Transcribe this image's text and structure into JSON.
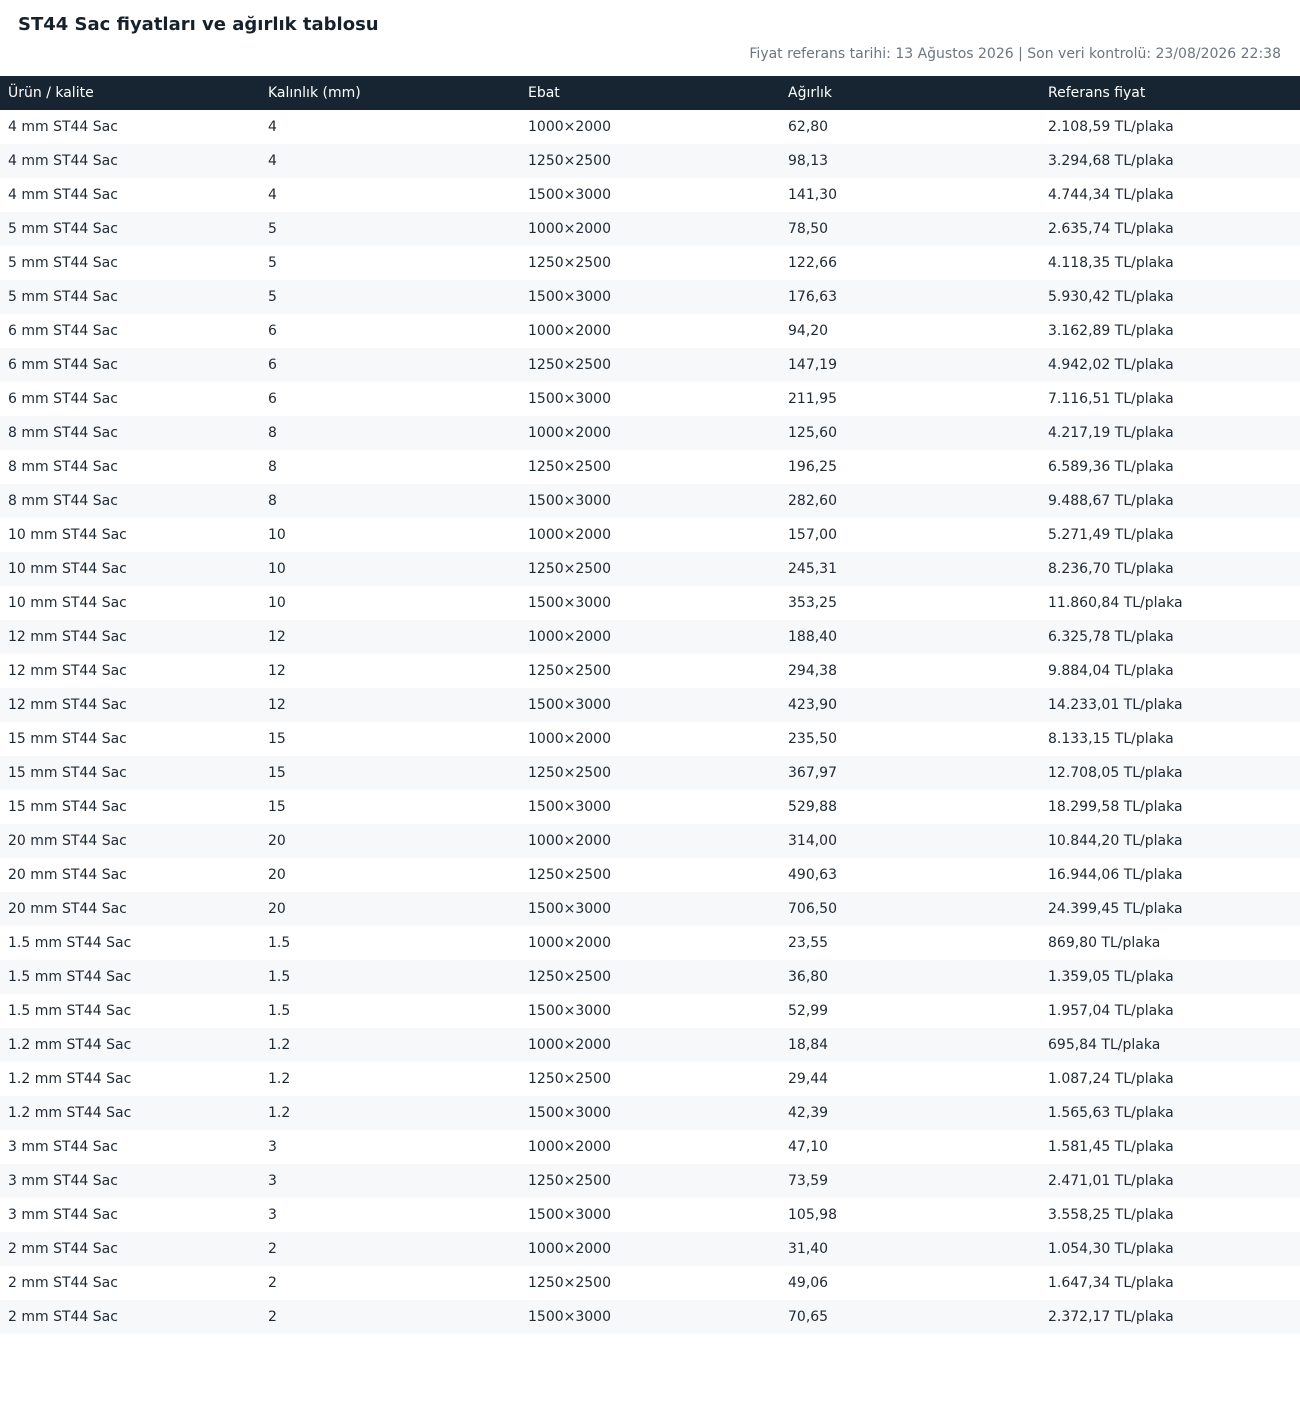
{
  "page": {
    "title": "ST44 Sac fiyatları ve ağırlık tablosu",
    "meta": "Fiyat referans tarihi: 13 Ağustos 2026 | Son veri kontrolü: 23/08/2026 22:38"
  },
  "colors": {
    "header_bg": "#172532",
    "header_text": "#ffffff",
    "row_alt_bg": "#f6f8fa",
    "meta_text": "#6c7580"
  },
  "table": {
    "headers": [
      "Ürün / kalite",
      "Kalınlık (mm)",
      "Ebat",
      "Ağırlık",
      "Referans fiyat"
    ],
    "rows": [
      [
        "4 mm ST44 Sac",
        "4",
        "1000×2000",
        "62,80",
        "2.108,59 TL/plaka"
      ],
      [
        "4 mm ST44 Sac",
        "4",
        "1250×2500",
        "98,13",
        "3.294,68 TL/plaka"
      ],
      [
        "4 mm ST44 Sac",
        "4",
        "1500×3000",
        "141,30",
        "4.744,34 TL/plaka"
      ],
      [
        "5 mm ST44 Sac",
        "5",
        "1000×2000",
        "78,50",
        "2.635,74 TL/plaka"
      ],
      [
        "5 mm ST44 Sac",
        "5",
        "1250×2500",
        "122,66",
        "4.118,35 TL/plaka"
      ],
      [
        "5 mm ST44 Sac",
        "5",
        "1500×3000",
        "176,63",
        "5.930,42 TL/plaka"
      ],
      [
        "6 mm ST44 Sac",
        "6",
        "1000×2000",
        "94,20",
        "3.162,89 TL/plaka"
      ],
      [
        "6 mm ST44 Sac",
        "6",
        "1250×2500",
        "147,19",
        "4.942,02 TL/plaka"
      ],
      [
        "6 mm ST44 Sac",
        "6",
        "1500×3000",
        "211,95",
        "7.116,51 TL/plaka"
      ],
      [
        "8 mm ST44 Sac",
        "8",
        "1000×2000",
        "125,60",
        "4.217,19 TL/plaka"
      ],
      [
        "8 mm ST44 Sac",
        "8",
        "1250×2500",
        "196,25",
        "6.589,36 TL/plaka"
      ],
      [
        "8 mm ST44 Sac",
        "8",
        "1500×3000",
        "282,60",
        "9.488,67 TL/plaka"
      ],
      [
        "10 mm ST44 Sac",
        "10",
        "1000×2000",
        "157,00",
        "5.271,49 TL/plaka"
      ],
      [
        "10 mm ST44 Sac",
        "10",
        "1250×2500",
        "245,31",
        "8.236,70 TL/plaka"
      ],
      [
        "10 mm ST44 Sac",
        "10",
        "1500×3000",
        "353,25",
        "11.860,84 TL/plaka"
      ],
      [
        "12 mm ST44 Sac",
        "12",
        "1000×2000",
        "188,40",
        "6.325,78 TL/plaka"
      ],
      [
        "12 mm ST44 Sac",
        "12",
        "1250×2500",
        "294,38",
        "9.884,04 TL/plaka"
      ],
      [
        "12 mm ST44 Sac",
        "12",
        "1500×3000",
        "423,90",
        "14.233,01 TL/plaka"
      ],
      [
        "15 mm ST44 Sac",
        "15",
        "1000×2000",
        "235,50",
        "8.133,15 TL/plaka"
      ],
      [
        "15 mm ST44 Sac",
        "15",
        "1250×2500",
        "367,97",
        "12.708,05 TL/plaka"
      ],
      [
        "15 mm ST44 Sac",
        "15",
        "1500×3000",
        "529,88",
        "18.299,58 TL/plaka"
      ],
      [
        "20 mm ST44 Sac",
        "20",
        "1000×2000",
        "314,00",
        "10.844,20 TL/plaka"
      ],
      [
        "20 mm ST44 Sac",
        "20",
        "1250×2500",
        "490,63",
        "16.944,06 TL/plaka"
      ],
      [
        "20 mm ST44 Sac",
        "20",
        "1500×3000",
        "706,50",
        "24.399,45 TL/plaka"
      ],
      [
        "1.5 mm ST44 Sac",
        "1.5",
        "1000×2000",
        "23,55",
        "869,80 TL/plaka"
      ],
      [
        "1.5 mm ST44 Sac",
        "1.5",
        "1250×2500",
        "36,80",
        "1.359,05 TL/plaka"
      ],
      [
        "1.5 mm ST44 Sac",
        "1.5",
        "1500×3000",
        "52,99",
        "1.957,04 TL/plaka"
      ],
      [
        "1.2 mm ST44 Sac",
        "1.2",
        "1000×2000",
        "18,84",
        "695,84 TL/plaka"
      ],
      [
        "1.2 mm ST44 Sac",
        "1.2",
        "1250×2500",
        "29,44",
        "1.087,24 TL/plaka"
      ],
      [
        "1.2 mm ST44 Sac",
        "1.2",
        "1500×3000",
        "42,39",
        "1.565,63 TL/plaka"
      ],
      [
        "3 mm ST44 Sac",
        "3",
        "1000×2000",
        "47,10",
        "1.581,45 TL/plaka"
      ],
      [
        "3 mm ST44 Sac",
        "3",
        "1250×2500",
        "73,59",
        "2.471,01 TL/plaka"
      ],
      [
        "3 mm ST44 Sac",
        "3",
        "1500×3000",
        "105,98",
        "3.558,25 TL/plaka"
      ],
      [
        "2 mm ST44 Sac",
        "2",
        "1000×2000",
        "31,40",
        "1.054,30 TL/plaka"
      ],
      [
        "2 mm ST44 Sac",
        "2",
        "1250×2500",
        "49,06",
        "1.647,34 TL/plaka"
      ],
      [
        "2 mm ST44 Sac",
        "2",
        "1500×3000",
        "70,65",
        "2.372,17 TL/plaka"
      ]
    ]
  }
}
